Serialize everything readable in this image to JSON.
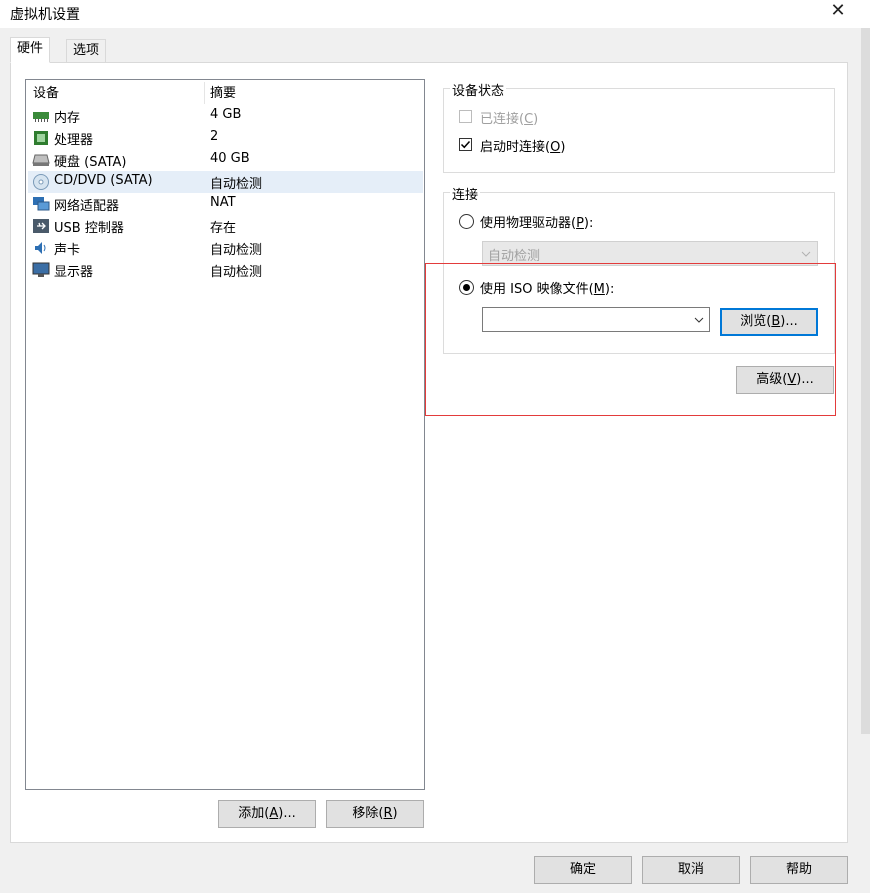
{
  "window": {
    "title": "虚拟机设置"
  },
  "tabs": [
    {
      "label": "硬件"
    },
    {
      "label": "选项"
    }
  ],
  "device_list": {
    "col_device": "设备",
    "col_summary": "摘要",
    "rows": [
      {
        "name": "内存",
        "summary": "4 GB",
        "icon": "memory-icon"
      },
      {
        "name": "处理器",
        "summary": "2",
        "icon": "cpu-icon"
      },
      {
        "name": "硬盘 (SATA)",
        "summary": "40 GB",
        "icon": "hard-disk-icon"
      },
      {
        "name": "CD/DVD (SATA)",
        "summary": "自动检测",
        "icon": "cd-dvd-icon",
        "selected": true
      },
      {
        "name": "网络适配器",
        "summary": "NAT",
        "icon": "network-icon"
      },
      {
        "name": "USB 控制器",
        "summary": "存在",
        "icon": "usb-icon"
      },
      {
        "name": "声卡",
        "summary": "自动检测",
        "icon": "sound-icon"
      },
      {
        "name": "显示器",
        "summary": "自动检测",
        "icon": "display-icon"
      }
    ]
  },
  "list_buttons": {
    "add_pre": "添加(",
    "add_key": "A",
    "add_post": ")...",
    "remove_pre": "移除(",
    "remove_key": "R",
    "remove_post": ")"
  },
  "device_status": {
    "label": "设备状态",
    "connected_pre": "已连接(",
    "connected_key": "C",
    "connected_post": ")",
    "connected_checked": false,
    "poweron_pre": "启动时连接(",
    "poweron_key": "O",
    "poweron_post": ")",
    "poweron_checked": true
  },
  "connection": {
    "label": "连接",
    "physical_pre": "使用物理驱动器(",
    "physical_key": "P",
    "physical_post": "):",
    "physical_value": "自动检测",
    "iso_pre": "使用 ISO 映像文件(",
    "iso_key": "M",
    "iso_post": "):",
    "iso_value": "",
    "browse_pre": "浏览(",
    "browse_key": "B",
    "browse_post": ")...",
    "selected": "iso"
  },
  "advanced": {
    "pre": "高级(",
    "key": "V",
    "post": ")..."
  },
  "footer": {
    "ok": "确定",
    "cancel": "取消",
    "help": "帮助"
  }
}
